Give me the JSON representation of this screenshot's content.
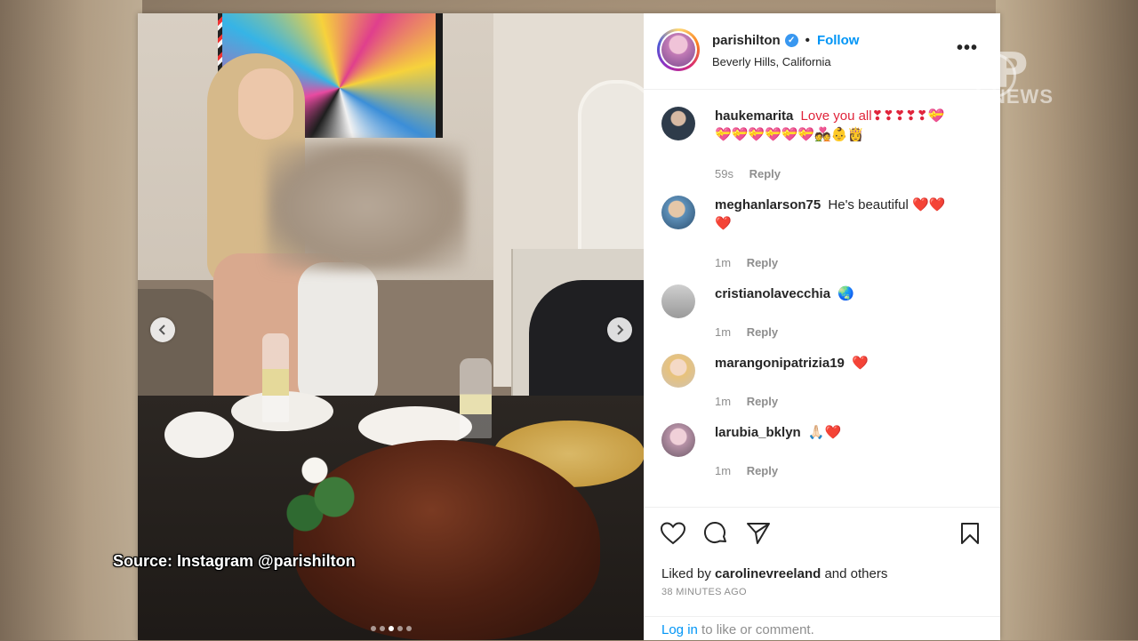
{
  "post": {
    "username": "parishilton",
    "follow_label": "Follow",
    "location": "Beverly Hills, California",
    "more_label": "•••",
    "image_count": 5,
    "active_image_index": 2
  },
  "comments": [
    {
      "user": "haukemarita",
      "text": "Love you all❣❣❣❣❣💝",
      "text2": "💝💝💝💝💝💝💑👶👸",
      "time": "59s",
      "reply": "Reply"
    },
    {
      "user": "meghanlarson75",
      "text": "He's beautiful ❤️❤️",
      "text2": "❤️",
      "time": "1m",
      "reply": "Reply"
    },
    {
      "user": "cristianolavecchia",
      "text": "🌏",
      "text2": "",
      "time": "1m",
      "reply": "Reply"
    },
    {
      "user": "marangonipatrizia19",
      "text": "❤️",
      "text2": "",
      "time": "1m",
      "reply": "Reply"
    },
    {
      "user": "larubia_bklyn",
      "text": "🙏🏻❤️",
      "text2": "",
      "time": "1m",
      "reply": "Reply"
    }
  ],
  "actions": {
    "liked_by_prefix": "Liked by",
    "liked_by_user": "carolinevreeland",
    "liked_by_suffix": "and others",
    "time_ago": "38 MINUTES AGO",
    "login_link": "Log in",
    "login_suffix": "to like or comment."
  },
  "overlay": {
    "source_caption": "Source: Instagram @parishilton",
    "watermark": "NEWS"
  },
  "colors": {
    "link_blue": "#0095f6",
    "verified_blue": "#3897f0",
    "heart_red": "#e0243b"
  }
}
